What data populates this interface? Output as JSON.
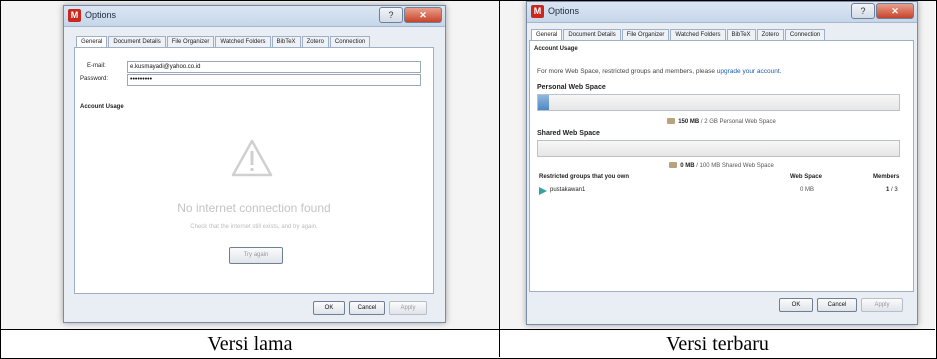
{
  "captions": {
    "left": "Versi lama",
    "right": "Versi terbaru"
  },
  "window_title": "Options",
  "tabs": [
    "General",
    "Document Details",
    "File Organizer",
    "Watched Folders",
    "BibTeX",
    "Zotero",
    "Connection"
  ],
  "old_version": {
    "email_label": "E-mail:",
    "email_value": "e.kusmayadi@yahoo.co.id",
    "password_label": "Password:",
    "password_value": "•••••••••",
    "section_title": "Account Usage",
    "warning_icon": "warning-triangle-icon",
    "error_title": "No internet connection found",
    "error_message": "Check that the internet still exists, and try again.",
    "try_again": "Try again"
  },
  "new_version": {
    "section_title": "Account Usage",
    "promo_prefix": "For more Web Space, restricted groups and members, please ",
    "promo_link": "upgrade your account.",
    "personal_title": "Personal Web Space",
    "personal_usage_fraction": 0.03,
    "personal_used": "150 MB",
    "personal_rest": " / 2 GB Personal Web Space",
    "shared_title": "Shared Web Space",
    "shared_usage_fraction": 0.0,
    "shared_used": "0 MB",
    "shared_rest": " / 100 MB Shared Web Space",
    "groups_header": "Restricted groups that you own",
    "web_space_header": "Web Space",
    "members_header": "Members",
    "group_name": "pustakawan1",
    "group_space": "0 MB",
    "group_members_used": "1",
    "group_members_total": " / 3"
  },
  "buttons": {
    "ok": "OK",
    "cancel": "Cancel",
    "apply": "Apply"
  },
  "colors": {
    "link": "#1d5fb4",
    "accent": "#4f87c3",
    "close": "#c8432b"
  }
}
